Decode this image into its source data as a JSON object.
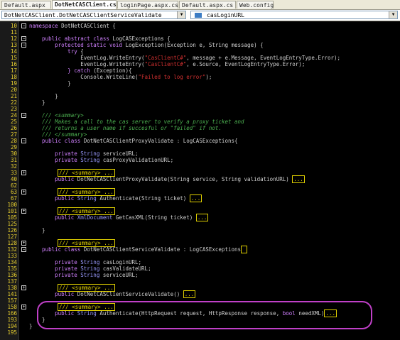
{
  "tabs": [
    {
      "label": "Default.aspx",
      "active": false
    },
    {
      "label": "DotNetCASClient.cs",
      "active": true
    },
    {
      "label": "loginPage.aspx.cs",
      "active": false
    },
    {
      "label": "Default.aspx.cs",
      "active": false
    },
    {
      "label": "Web.config",
      "active": false
    }
  ],
  "navbar": {
    "class_combo": "DotNetCASClient.DotNetCASClientServiceValidate",
    "member_combo": "casLoginURL"
  },
  "lines": [
    {
      "n": "10",
      "fold": "-",
      "parts": [
        [
          "kw",
          "namespace "
        ],
        [
          "tx",
          "DotNetCASClient {"
        ]
      ]
    },
    {
      "n": "11",
      "parts": []
    },
    {
      "n": "12",
      "fold": "-",
      "parts": [
        [
          "kw",
          "    public abstract class "
        ],
        [
          "tx",
          "LogCASExceptions {"
        ]
      ]
    },
    {
      "n": "13",
      "fold": "-",
      "parts": [
        [
          "kw",
          "        protected static void "
        ],
        [
          "tx",
          "LogException(Exception e, String message) {"
        ]
      ]
    },
    {
      "n": "14",
      "parts": [
        [
          "kw",
          "            try "
        ],
        [
          "tx",
          "{"
        ]
      ]
    },
    {
      "n": "15",
      "parts": [
        [
          "tx",
          "                EventLog.WriteEntry("
        ],
        [
          "st",
          "\"CasClientC#\""
        ],
        [
          "tx",
          ", message + e.Message, EventLogEntryType.Error);"
        ]
      ]
    },
    {
      "n": "16",
      "parts": [
        [
          "tx",
          "                EventLog.WriteEntry("
        ],
        [
          "st",
          "\"CasClientC#\""
        ],
        [
          "tx",
          ", e.Source, EventLogEntryType.Error);"
        ]
      ]
    },
    {
      "n": "17",
      "parts": [
        [
          "kw",
          "            } catch "
        ],
        [
          "tx",
          "(Exception){"
        ]
      ]
    },
    {
      "n": "18",
      "parts": [
        [
          "tx",
          "                Console.WriteLine("
        ],
        [
          "st",
          "\"Failed to log error\""
        ],
        [
          "tx",
          ");"
        ]
      ]
    },
    {
      "n": "19",
      "parts": [
        [
          "tx",
          "            }"
        ]
      ]
    },
    {
      "n": "20",
      "parts": []
    },
    {
      "n": "21",
      "parts": [
        [
          "tx",
          "        }"
        ]
      ]
    },
    {
      "n": "22",
      "parts": [
        [
          "tx",
          "    }"
        ]
      ]
    },
    {
      "n": "23",
      "parts": []
    },
    {
      "n": "24",
      "fold": "-",
      "parts": [
        [
          "cm",
          "    /// <summary>"
        ]
      ]
    },
    {
      "n": "25",
      "parts": [
        [
          "cm",
          "    /// Makes a call to the cas server to verify a proxy ticket and"
        ]
      ]
    },
    {
      "n": "26",
      "parts": [
        [
          "cm",
          "    /// returns a user name if succesful or \"failed\" if not."
        ]
      ]
    },
    {
      "n": "27",
      "parts": [
        [
          "cm",
          "    /// </summary>"
        ]
      ]
    },
    {
      "n": "28",
      "fold": "-",
      "parts": [
        [
          "kw",
          "    public class "
        ],
        [
          "tx",
          "DotNetCASClientProxyValidate : LogCASExceptions{"
        ]
      ]
    },
    {
      "n": "29",
      "parts": []
    },
    {
      "n": "30",
      "parts": [
        [
          "kw",
          "        private "
        ],
        [
          "ty",
          "String "
        ],
        [
          "tx",
          "serviceURL;"
        ]
      ]
    },
    {
      "n": "31",
      "parts": [
        [
          "kw",
          "        private "
        ],
        [
          "ty",
          "String "
        ],
        [
          "tx",
          "casProxyValidationURL;"
        ]
      ]
    },
    {
      "n": "32",
      "parts": []
    },
    {
      "n": "33",
      "fold": "+",
      "parts": [
        [
          "ph",
          "/// <summary> ..."
        ]
      ]
    },
    {
      "n": "40",
      "parts": [
        [
          "kw",
          "        public "
        ],
        [
          "tx",
          "DotNetCASClientProxyValidate(String service, String validationURL) "
        ],
        [
          "ph",
          "..."
        ]
      ]
    },
    {
      "n": "62",
      "parts": []
    },
    {
      "n": "63",
      "fold": "+",
      "parts": [
        [
          "ph",
          "/// <summary> ..."
        ]
      ]
    },
    {
      "n": "67",
      "parts": [
        [
          "kw",
          "        public "
        ],
        [
          "ty",
          "String "
        ],
        [
          "tx",
          "Authenticate(String ticket) "
        ],
        [
          "ph",
          "..."
        ]
      ]
    },
    {
      "n": "100",
      "parts": []
    },
    {
      "n": "101",
      "fold": "+",
      "parts": [
        [
          "ph",
          "/// <summary> ..."
        ]
      ]
    },
    {
      "n": "105",
      "parts": [
        [
          "kw",
          "        public "
        ],
        [
          "ty",
          "XmlDocument "
        ],
        [
          "tx",
          "GetCasXML(String ticket) "
        ],
        [
          "ph",
          "..."
        ]
      ]
    },
    {
      "n": "125",
      "parts": []
    },
    {
      "n": "126",
      "parts": [
        [
          "tx",
          "    }"
        ]
      ]
    },
    {
      "n": "127",
      "parts": []
    },
    {
      "n": "128",
      "fold": "+",
      "parts": [
        [
          "ph",
          "/// <summary> ..."
        ]
      ]
    },
    {
      "n": "132",
      "fold": "-",
      "parts": [
        [
          "kw",
          "    public class "
        ],
        [
          "tx",
          "DotNetCASClientServiceValidate : LogCASExceptions"
        ],
        [
          "ph",
          " "
        ]
      ]
    },
    {
      "n": "133",
      "parts": []
    },
    {
      "n": "134",
      "parts": [
        [
          "kw",
          "        private "
        ],
        [
          "ty",
          "String "
        ],
        [
          "tx",
          "casLoginURL;"
        ]
      ]
    },
    {
      "n": "135",
      "parts": [
        [
          "kw",
          "        private "
        ],
        [
          "ty",
          "String "
        ],
        [
          "tx",
          "casValidateURL;"
        ]
      ]
    },
    {
      "n": "136",
      "parts": [
        [
          "kw",
          "        private "
        ],
        [
          "ty",
          "String "
        ],
        [
          "tx",
          "serviceURL;"
        ]
      ]
    },
    {
      "n": "137",
      "parts": []
    },
    {
      "n": "138",
      "fold": "+",
      "parts": [
        [
          "ph",
          "/// <summary> ..."
        ]
      ]
    },
    {
      "n": "141",
      "parts": [
        [
          "kw",
          "        public "
        ],
        [
          "tx",
          "DotNetCASClientServiceValidate() "
        ],
        [
          "ph",
          "..."
        ]
      ]
    },
    {
      "n": "157",
      "parts": []
    },
    {
      "n": "158",
      "fold": "+",
      "parts": [
        [
          "ph",
          "/// <summary> ..."
        ]
      ]
    },
    {
      "n": "166",
      "parts": [
        [
          "kw",
          "        public "
        ],
        [
          "ty",
          "String "
        ],
        [
          "tx",
          "Authenticate(HttpRequest request, HttpResponse response, "
        ],
        [
          "kw",
          "bool "
        ],
        [
          "tx",
          "needXML)"
        ],
        [
          "ph",
          "..."
        ]
      ]
    },
    {
      "n": "193",
      "parts": [
        [
          "tx",
          "    }"
        ]
      ]
    },
    {
      "n": "194",
      "parts": [
        [
          "tx",
          "}"
        ]
      ]
    },
    {
      "n": "195",
      "parts": []
    }
  ]
}
